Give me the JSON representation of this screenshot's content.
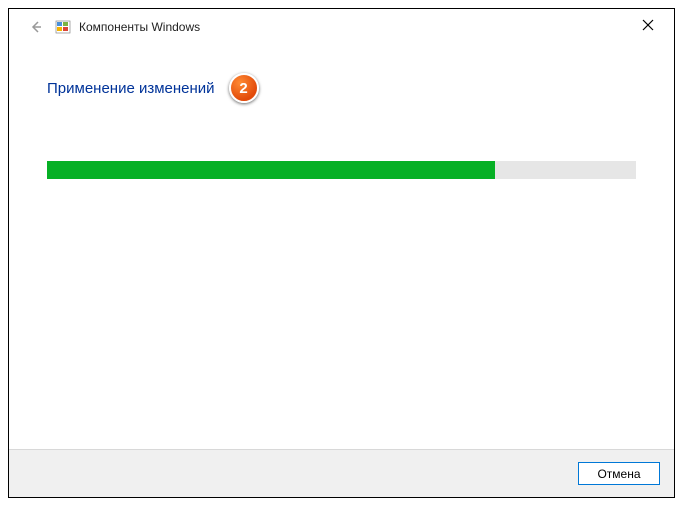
{
  "titlebar": {
    "title": "Компоненты Windows"
  },
  "content": {
    "heading": "Применение изменений",
    "callout_number": "2",
    "progress_percent": 76
  },
  "footer": {
    "cancel_label": "Отмена"
  }
}
